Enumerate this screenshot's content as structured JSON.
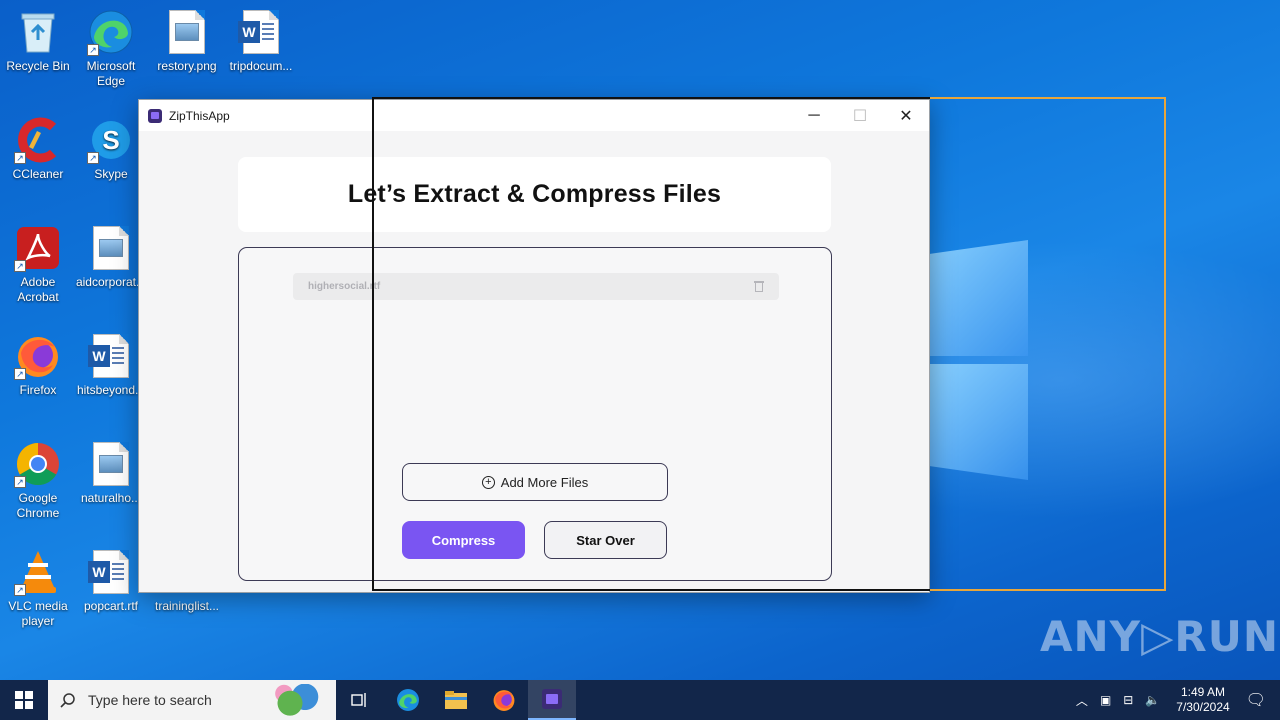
{
  "desktop": {
    "icons": [
      {
        "label": "Recycle Bin"
      },
      {
        "label": "Microsoft Edge"
      },
      {
        "label": "restory.png"
      },
      {
        "label": "tripdocum..."
      },
      {
        "label": "CCleaner"
      },
      {
        "label": "Skype"
      },
      {
        "label": "Adobe Acrobat"
      },
      {
        "label": "aidcorporat..."
      },
      {
        "label": "Firefox"
      },
      {
        "label": "hitsbeyond..."
      },
      {
        "label": "Google Chrome"
      },
      {
        "label": "naturalho..."
      },
      {
        "label": "VLC media player"
      },
      {
        "label": "popcart.rtf"
      },
      {
        "label": "traininglist..."
      }
    ]
  },
  "window": {
    "title": "ZipThisApp",
    "minimize": "─",
    "maximize": "☐",
    "close": "✕"
  },
  "app": {
    "heading": "Let’s Extract & Compress Files",
    "files": [
      {
        "name": "highersocial.rtf"
      }
    ],
    "add_more_label": "Add More Files",
    "compress_label": "Compress",
    "start_over_label": "Star Over",
    "accent_color": "#7a55f2"
  },
  "watermark": "ANY▷RUN",
  "taskbar": {
    "search_placeholder": "Type here to search",
    "time": "1:49 AM",
    "date": "7/30/2024"
  }
}
